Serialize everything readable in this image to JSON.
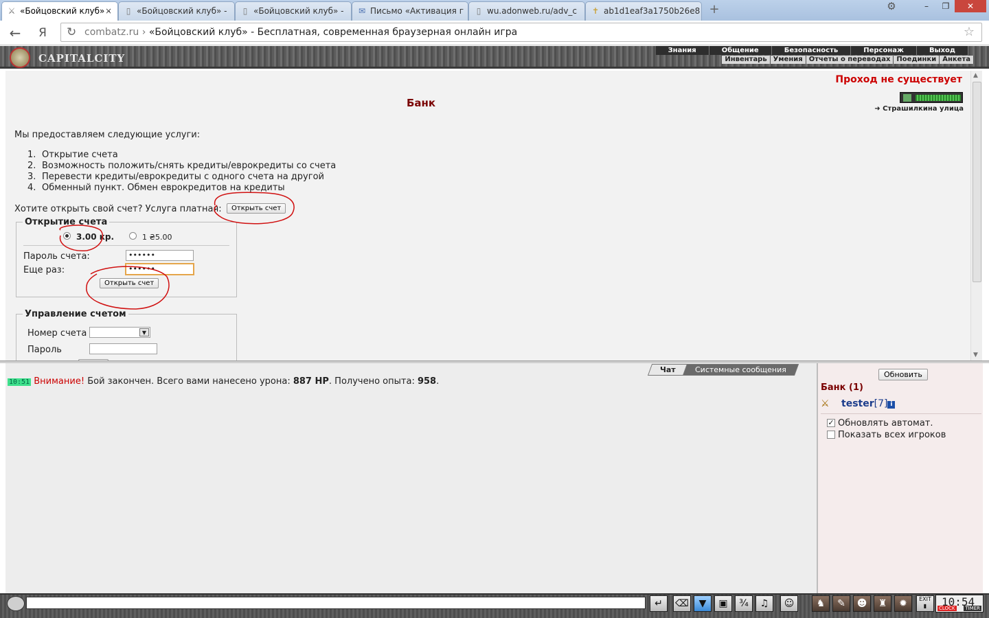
{
  "browser": {
    "tabs": [
      {
        "title": "«Бойцовский клуб» -",
        "icon": "sword-icon",
        "active": true
      },
      {
        "title": "«Бойцовский клуб» -",
        "icon": "page-icon",
        "active": false
      },
      {
        "title": "«Бойцовский клуб» -",
        "icon": "page-icon",
        "active": false
      },
      {
        "title": "Письмо «Активация г",
        "icon": "mail-icon",
        "active": false
      },
      {
        "title": "wu.adonweb.ru/adv_c",
        "icon": "page-icon",
        "active": false
      },
      {
        "title": "ab1d1eaf3a1750b26e8",
        "icon": "cross-icon",
        "active": false
      }
    ],
    "yandex_label": "Я",
    "url_domain": "combatz.ru",
    "url_separator": "›",
    "page_title": "«Бойцовский клуб» - Бесплатная, современная браузерная онлайн игра"
  },
  "game": {
    "logo_text": "CAPITALCITY",
    "top_menu": [
      "Знания",
      "Общение",
      "Безопасность",
      "Персонаж",
      "Выход"
    ],
    "sub_menu": [
      "Инвентарь",
      "Умения",
      "Отчеты о переводах",
      "Поединки",
      "Анкета"
    ]
  },
  "bank": {
    "warning": "Проход не существует",
    "street_link": "Страшилкина улица",
    "title": "Банк",
    "intro": "Мы предоставляем следующие услуги:",
    "services": [
      "Открытие счета",
      "Возможность положить/снять кредиты/еврокредиты со счета",
      "Перевести кредиты/еврокредиты с одного счета на другой",
      "Обменный пункт. Обмен еврокредитов на кредиты"
    ],
    "question": "Хотите открыть свой счет? Услуга платная:",
    "open_button": "Открыть счет",
    "open_form": {
      "legend": "Открытие счета",
      "option_price": "3.00 кр.",
      "option_euro": "1 ₴5.00",
      "password_label": "Пароль счета:",
      "password_value": "••••••",
      "repeat_label": "Еще раз:",
      "repeat_value": "••••••",
      "submit": "Открыть счет"
    },
    "management": {
      "legend": "Управление счетом",
      "account_label": "Номер счета",
      "password_label": "Пароль"
    }
  },
  "chat": {
    "tabs": [
      "Чат",
      "Системные сообщения"
    ],
    "message": {
      "time": "10:51",
      "warning": "Внимание!",
      "text_before": " Бой закончен. Всего вами нанесено урона: ",
      "damage": "887 HP",
      "text_middle": ". Получено опыта: ",
      "exp": "958",
      "text_after": "."
    }
  },
  "players": {
    "refresh_button": "Обновить",
    "room": "Банк (1)",
    "list": [
      {
        "name": "tester",
        "level": "[7]"
      }
    ],
    "auto_refresh_label": "Обновлять автомат.",
    "show_all_label": "Показать всех игроков"
  },
  "clock": {
    "time": "10:54",
    "label_left": "CLOCK",
    "label_right": "TIMER",
    "exit": "EXIT"
  },
  "colors": {
    "accent_red": "#c00000",
    "bank_title": "#7a0000",
    "player_link": "#1c3d8c",
    "chat_time_bg": "#3ee08c"
  }
}
